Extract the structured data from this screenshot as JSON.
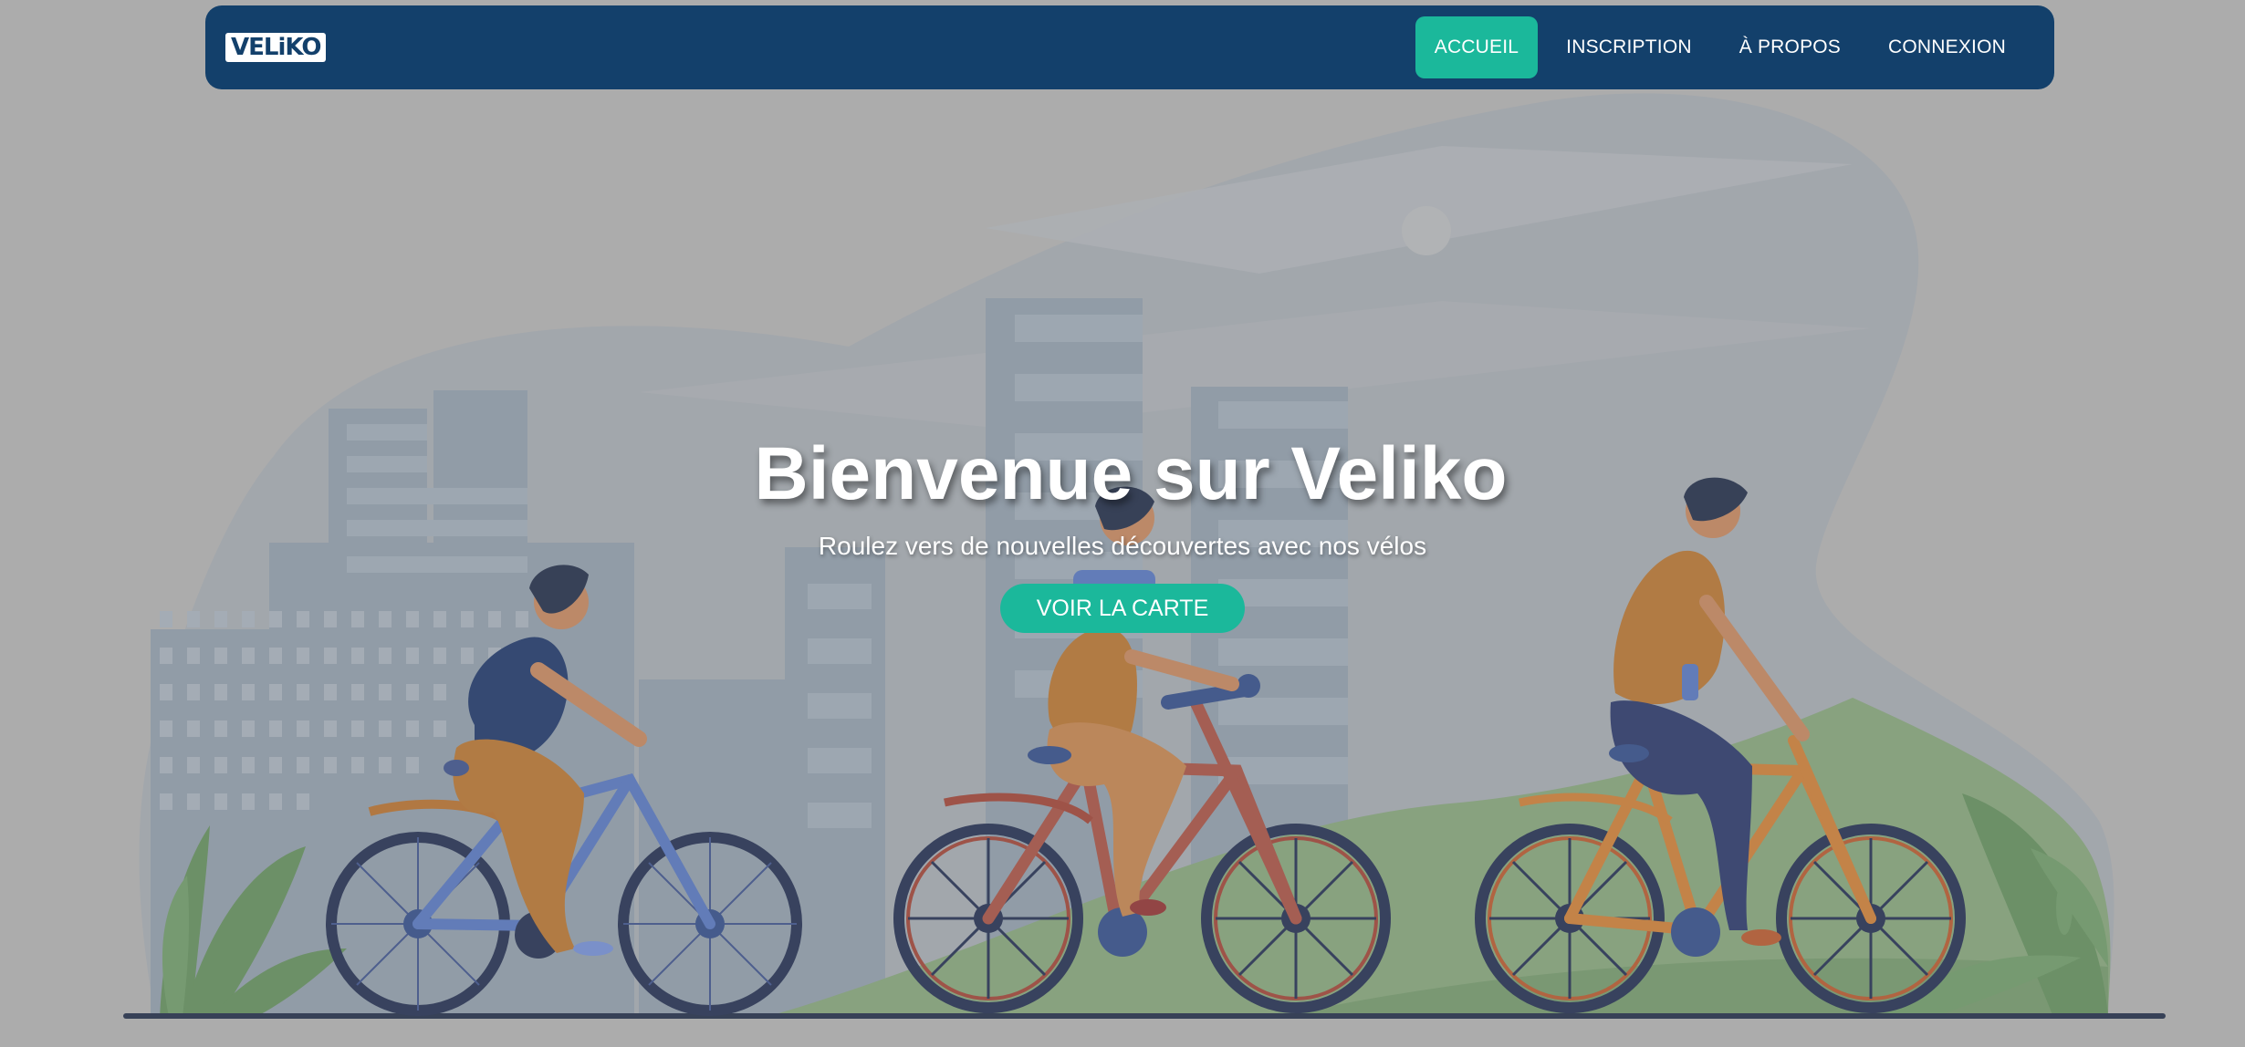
{
  "nav": {
    "logo_text": "VELiKO",
    "items": [
      {
        "label": "ACCUEIL",
        "active": true
      },
      {
        "label": "INSCRIPTION",
        "active": false
      },
      {
        "label": "À PROPOS",
        "active": false
      },
      {
        "label": "CONNEXION",
        "active": false
      }
    ]
  },
  "hero": {
    "title": "Bienvenue sur Veliko",
    "subtitle": "Roulez vers de nouvelles découvertes avec nos vélos",
    "cta_label": "VOIR LA CARTE"
  },
  "colors": {
    "nav_bg": "#13406b",
    "accent": "#1bb89b",
    "page_bg": "#acacac"
  }
}
